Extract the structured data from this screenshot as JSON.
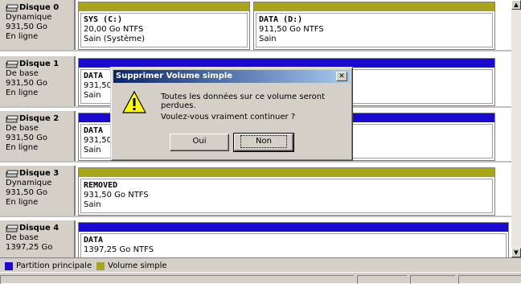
{
  "disks": [
    {
      "name": "Disque 0",
      "type": "Dynamique",
      "size": "931,50 Go",
      "status": "En ligne",
      "volumes": [
        {
          "bar": "simple",
          "name": "SYS (C:)",
          "detail": "20,00 Go NTFS",
          "health": "Sain (Système)"
        },
        {
          "bar": "simple",
          "name": "DATA (D:)",
          "detail": "911,50 Go NTFS",
          "health": "Sain"
        }
      ]
    },
    {
      "name": "Disque 1",
      "type": "De base",
      "size": "931,50 Go",
      "status": "En ligne",
      "volumes": [
        {
          "bar": "primary",
          "name": "DATA",
          "detail": "931,50",
          "health": "Sain"
        }
      ]
    },
    {
      "name": "Disque 2",
      "type": "De base",
      "size": "931,50 Go",
      "status": "En ligne",
      "volumes": [
        {
          "bar": "primary",
          "name": "DATA",
          "detail": "931,50",
          "health": "Sain"
        }
      ]
    },
    {
      "name": "Disque 3",
      "type": "Dynamique",
      "size": "931,50 Go",
      "status": "En ligne",
      "volumes": [
        {
          "bar": "simple",
          "name": "REMOVED",
          "detail": "931,50 Go NTFS",
          "health": "Sain"
        }
      ]
    },
    {
      "name": "Disque 4",
      "type": "De base",
      "size": "1397,25 Go",
      "status": "",
      "volumes": [
        {
          "bar": "primary",
          "name": "DATA",
          "detail": "1397,25 Go NTFS",
          "health": ""
        }
      ]
    }
  ],
  "legend": {
    "primary_label": "Partition principale",
    "simple_label": "Volume simple"
  },
  "colors": {
    "primary": "#1a0ad0",
    "simple": "#a8a41e"
  },
  "dialog": {
    "title": "Supprimer Volume simple",
    "close_glyph": "✕",
    "message_line1": "Toutes les données sur ce volume seront perdues.",
    "message_line2": "Voulez-vous vraiment continuer ?",
    "yes_label": "Oui",
    "no_label": "Non",
    "icon": "warning-icon"
  },
  "scrollbar": {
    "up_glyph": "▲",
    "down_glyph": "▼"
  }
}
